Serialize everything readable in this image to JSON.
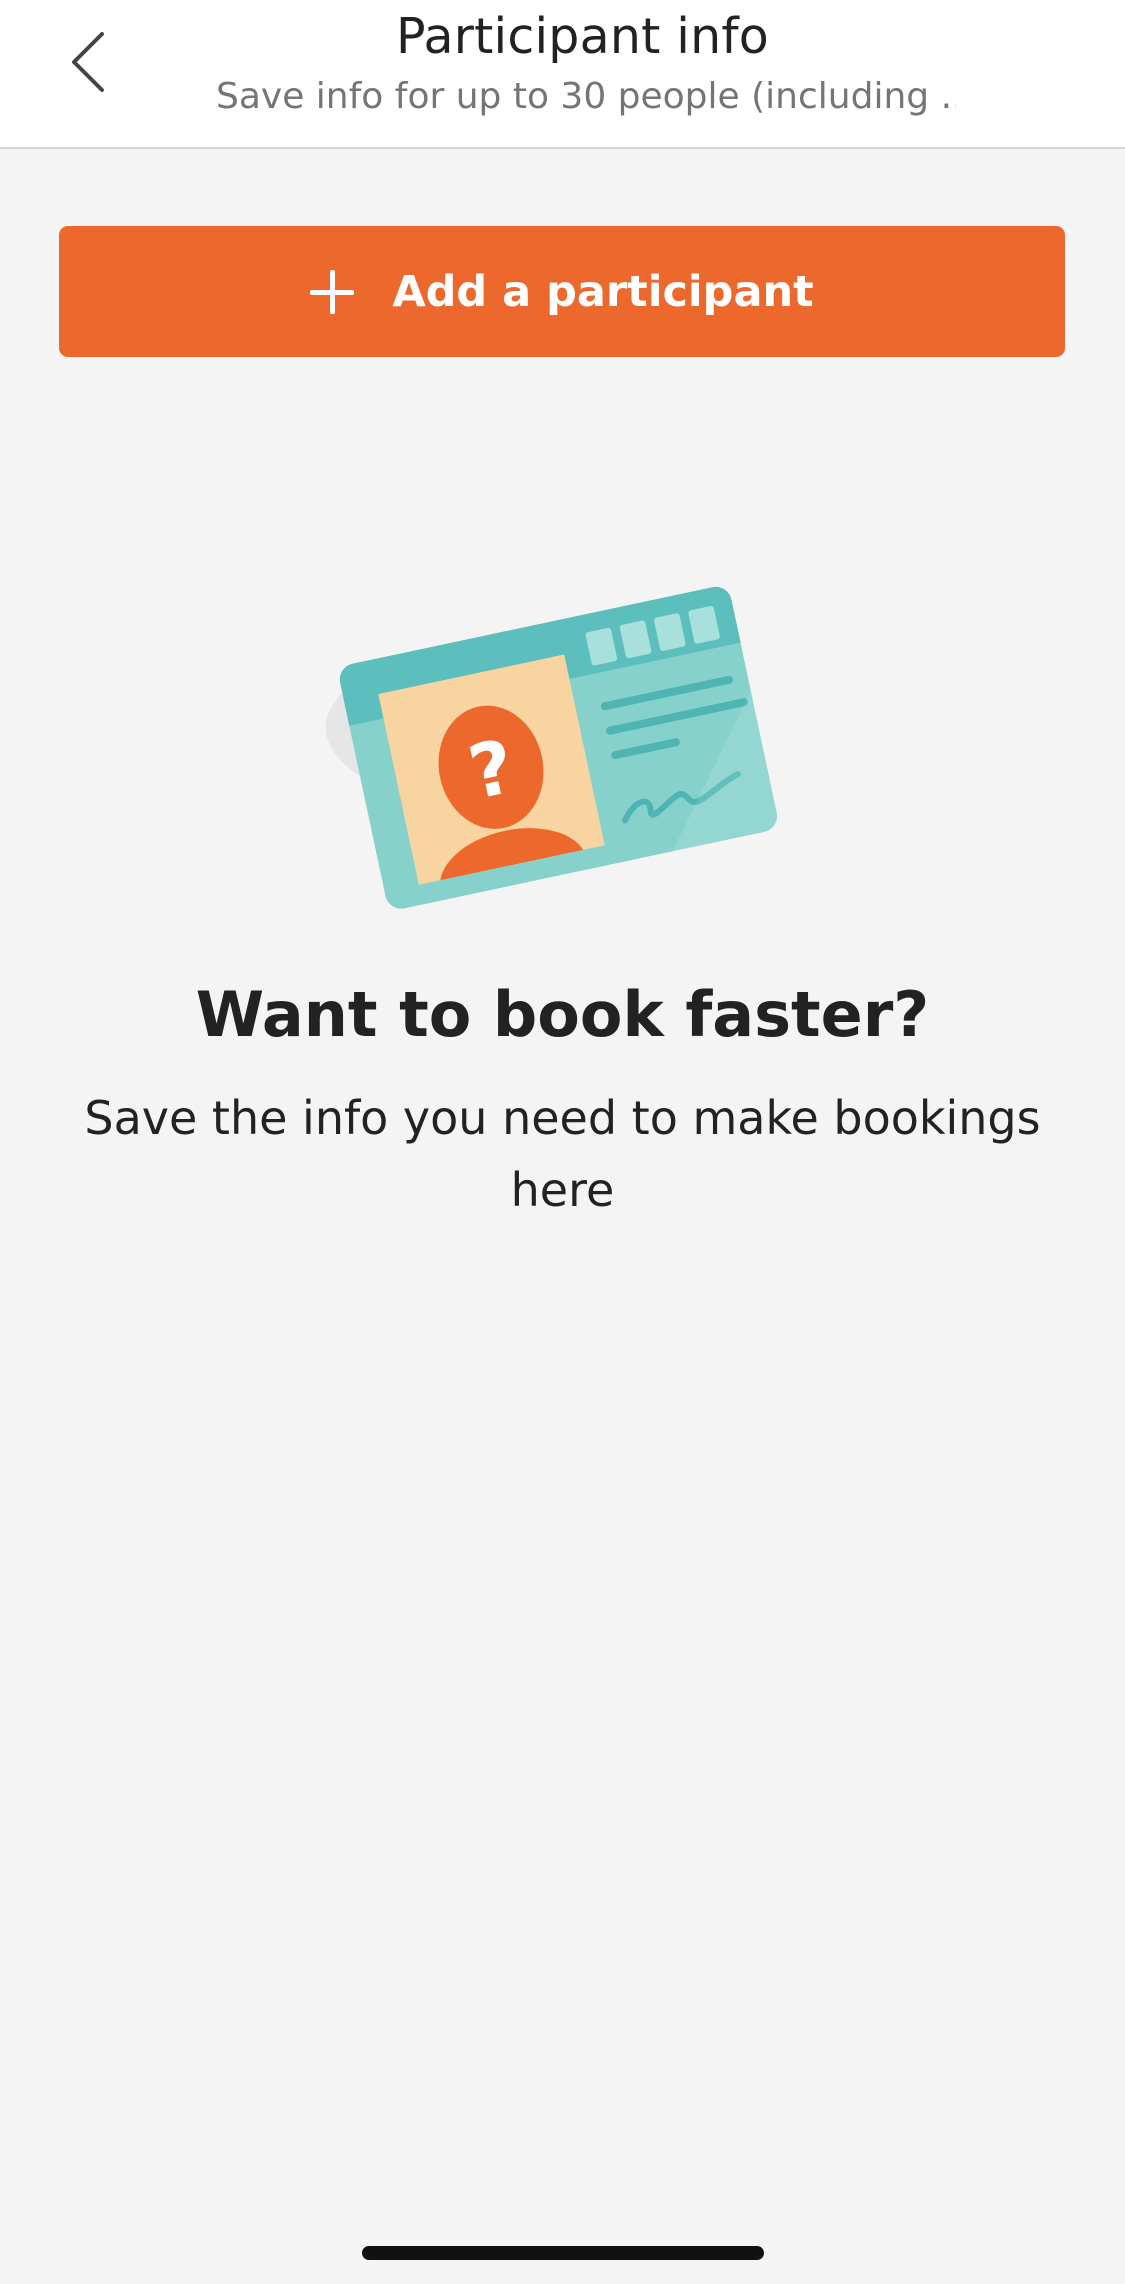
{
  "header": {
    "title": "Participant info",
    "subtitle": "Save info for up to 30 people (including ..."
  },
  "icons": {
    "back": "chevron-left-icon",
    "add": "plus-icon",
    "illustration": "id-card-illustration"
  },
  "add_button": {
    "label": "Add a participant"
  },
  "empty_state": {
    "headline": "Want to book faster?",
    "body": "Save the info you need to make bookings here",
    "card_glyph": "?"
  },
  "colors": {
    "accent": "#ec682c",
    "card_teal": "#5dbfbd",
    "card_light": "#86d1cc",
    "photo_bg": "#f8d5a0",
    "background": "#f4f4f4"
  }
}
